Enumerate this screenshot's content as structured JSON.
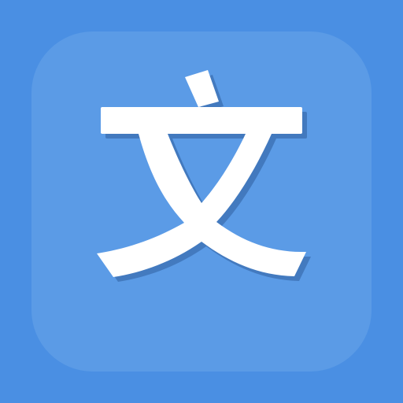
{
  "icon": {
    "glyph_text": "文",
    "icon_name": "translate-app-icon",
    "colors": {
      "background": "#4a8fe3",
      "tile": "#5b9be6",
      "glyph": "#ffffff",
      "glyph_shadow": "#2f5f9e"
    }
  }
}
